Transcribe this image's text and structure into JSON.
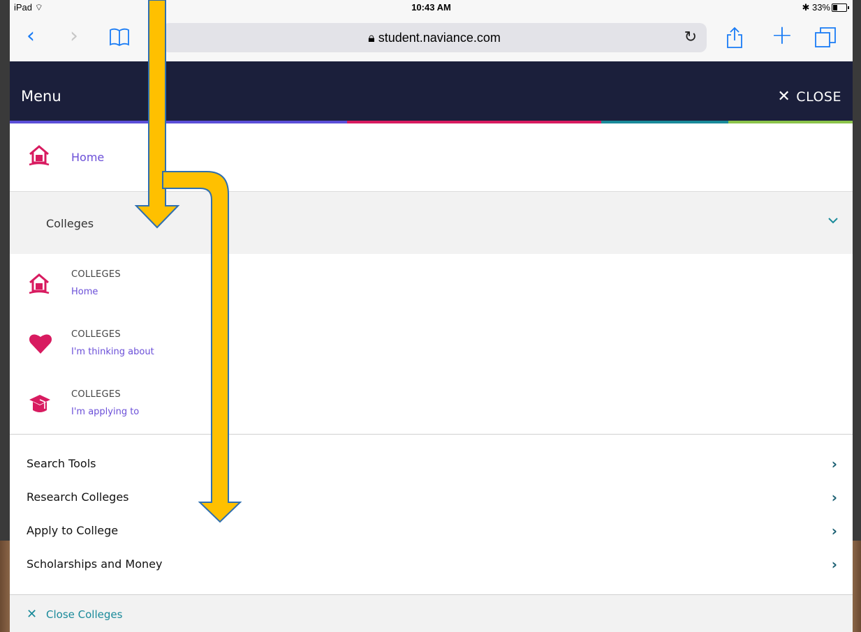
{
  "status_bar": {
    "device": "iPad",
    "time": "10:43 AM",
    "battery_text": "33%",
    "battery_level": 0.33
  },
  "browser": {
    "url": "student.naviance.com"
  },
  "menu": {
    "title": "Menu",
    "close_label": "CLOSE",
    "stripe_colors": [
      "#5b4fd8",
      "#d81b60",
      "#1a8a9a",
      "#8bc34a"
    ]
  },
  "nav": {
    "home_label": "Home",
    "section_label": "Colleges",
    "sub_items": [
      {
        "kicker": "COLLEGES",
        "name": "Home",
        "icon": "house-icon"
      },
      {
        "kicker": "COLLEGES",
        "name": "I'm thinking about",
        "icon": "heart-icon"
      },
      {
        "kicker": "COLLEGES",
        "name": "I'm applying to",
        "icon": "graduation-cap-icon"
      }
    ],
    "links": [
      "Search Tools",
      "Research Colleges",
      "Apply to College",
      "Scholarships and Money"
    ],
    "close_section_label": "Close Colleges"
  },
  "colors": {
    "header_bg": "#1b1f3b",
    "accent_pink": "#d81b60",
    "accent_purple": "#6b4fd8",
    "accent_teal": "#1a8a9a",
    "annotation_arrow": "#ffc000"
  }
}
